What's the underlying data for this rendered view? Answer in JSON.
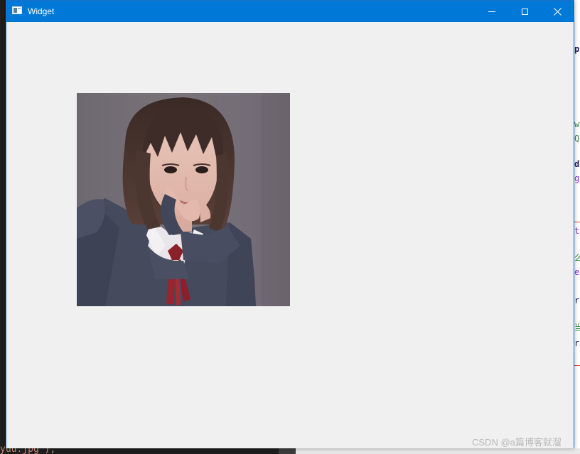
{
  "window": {
    "title": "Widget"
  },
  "titlebar_buttons": {
    "minimize_icon": "minimize-icon",
    "maximize_icon": "maximize-icon",
    "close_icon": "close-icon"
  },
  "image": {
    "description_icon": "photo-image"
  },
  "background_editor": {
    "bottom_code_fragment": "yuu.jpg\");",
    "right_edge_chars": [
      "p",
      "w",
      "Q",
      "d",
      "g",
      "t",
      "么",
      "e",
      "r",
      "当",
      "r"
    ]
  },
  "watermark": "CSDN @a篇博客就溜",
  "colors": {
    "titlebar": "#0078d7",
    "client_background": "#f0f0f0"
  }
}
